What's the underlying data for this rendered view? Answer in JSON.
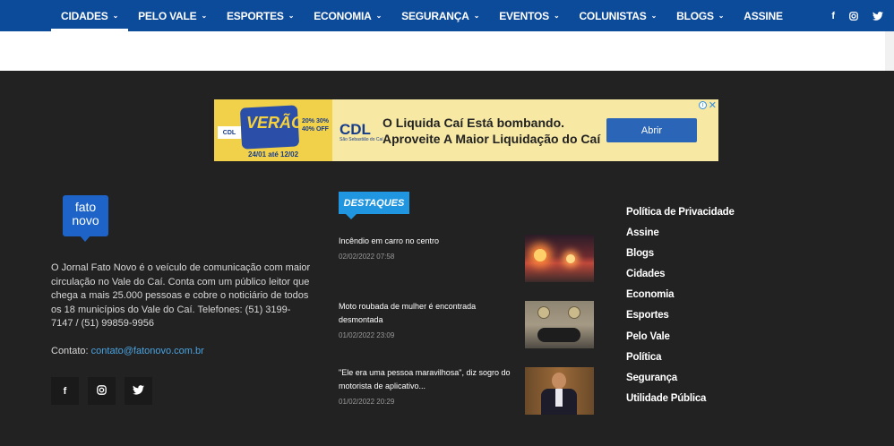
{
  "nav": {
    "items": [
      {
        "label": "CIDADES",
        "chevron": true,
        "active": true
      },
      {
        "label": "PELO VALE",
        "chevron": true
      },
      {
        "label": "ESPORTES",
        "chevron": true
      },
      {
        "label": "ECONOMIA",
        "chevron": true
      },
      {
        "label": "SEGURANÇA",
        "chevron": true
      },
      {
        "label": "EVENTOS",
        "chevron": true
      },
      {
        "label": "COLUNISTAS",
        "chevron": true
      },
      {
        "label": "BLOGS",
        "chevron": true
      },
      {
        "label": "ASSINE",
        "chevron": false
      }
    ],
    "chevron_glyph": "⌄",
    "social": [
      "facebook-icon",
      "instagram-icon",
      "twitter-icon"
    ]
  },
  "ad": {
    "headline_1": "O Liquida Caí Está bombando.",
    "headline_2": "Aproveite A Maior Liquidação do Caí",
    "button": "Abrir",
    "brand": "CDL",
    "brand_sub": "São Sebastião do Caí",
    "art_brand": "CDL",
    "art_title": "VERÃO",
    "art_dates": "24/01 até 12/02",
    "art_percent": "20% 30% 40% OFF",
    "info_glyph": "i",
    "close_glyph": "✕"
  },
  "footer": {
    "logo_line1": "fato",
    "logo_line2": "novo",
    "about": "O Jornal Fato Novo é o veículo de comunicação com maior circulação no Vale do Caí. Conta com um público leitor que chega a mais 25.000 pessoas e cobre o noticiário de todos os 18 municípios do Vale do Caí. Telefones: (51) 3199-7147 / (51) 99859-9956",
    "contact_label": "Contato:",
    "contact_email": "contato@fatonovo.com.br",
    "social_glyphs": {
      "facebook": "f",
      "instagram": "◎",
      "twitter": "🐦"
    }
  },
  "destaques": {
    "title": "DESTAQUES",
    "items": [
      {
        "title": "Incêndio em carro no centro",
        "date": "02/02/2022 07:58"
      },
      {
        "title": "Moto roubada de mulher é encontrada desmontada",
        "date": "01/02/2022 23:09"
      },
      {
        "title": "\"Ele era uma pessoa maravilhosa\", diz sogro do motorista de aplicativo...",
        "date": "01/02/2022 20:29"
      }
    ]
  },
  "links": [
    "Política de Privacidade",
    "Assine",
    "Blogs",
    "Cidades",
    "Economia",
    "Esportes",
    "Pelo Vale",
    "Política",
    "Segurança",
    "Utilidade Pública"
  ],
  "colors": {
    "nav_bg": "#0c4a9a",
    "footer_bg": "#222222",
    "accent": "#2196e0"
  }
}
